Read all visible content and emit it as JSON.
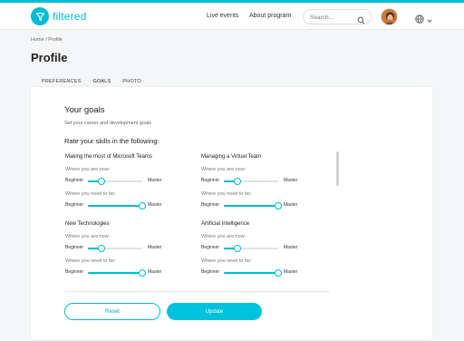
{
  "colors": {
    "accent": "#00bcd4",
    "track": "#dfe3e6"
  },
  "header": {
    "logo_text": "filtered",
    "logo_icon": "funnel-icon",
    "nav": {
      "live_events": "Live events",
      "about_program": "About program"
    },
    "search": {
      "placeholder": "Search..."
    },
    "lang_icon": "globe-icon"
  },
  "breadcrumb": {
    "home": "Home",
    "separator": "/",
    "current": "Profile"
  },
  "page_title": "Profile",
  "tabs": [
    {
      "label": "PREFERENCES",
      "active": false
    },
    {
      "label": "GOALS",
      "active": true
    },
    {
      "label": "PHOTO",
      "active": false
    }
  ],
  "goals": {
    "title": "Your goals",
    "subtitle": "Set your career and development goals",
    "rate_heading": "Rate your skills in the following:",
    "current_label": "Where you are now:",
    "target_label": "Where you need to be:",
    "min_label": "Beginner",
    "max_label": "Master",
    "skills": [
      {
        "name": "Making the most of Microsoft Teams",
        "now": 0.25,
        "target": 1.0
      },
      {
        "name": "Managing a Virtual Team",
        "now": 0.25,
        "target": 1.0
      },
      {
        "name": "New Technologies",
        "now": 0.25,
        "target": 1.0
      },
      {
        "name": "Artificial Intelligence",
        "now": 0.25,
        "target": 1.0
      }
    ]
  },
  "buttons": {
    "reset": "Reset",
    "update": "Update"
  }
}
